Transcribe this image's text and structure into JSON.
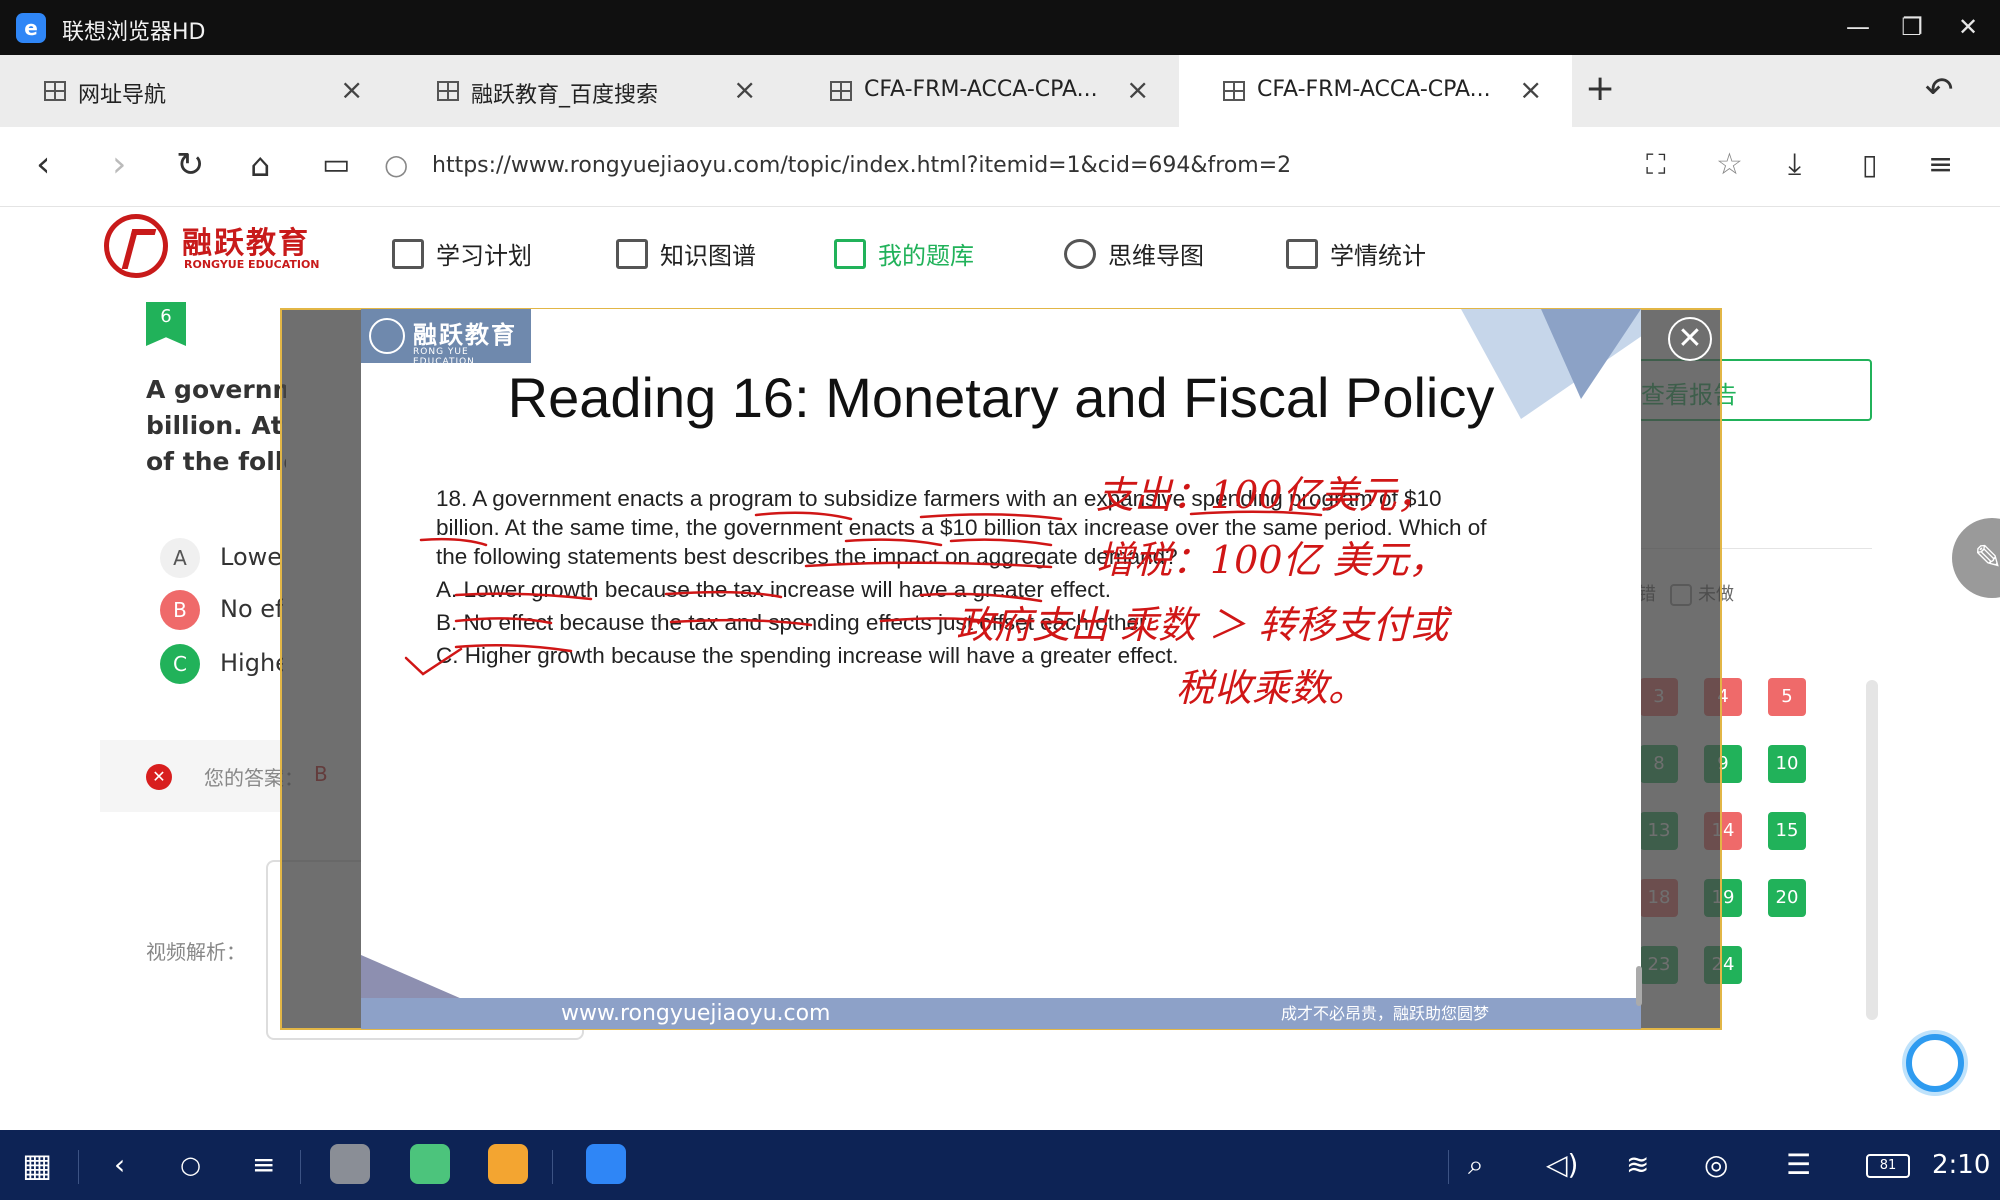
{
  "window": {
    "title": "联想浏览器HD",
    "minimize": "—",
    "restore": "❐",
    "close": "✕"
  },
  "tabs": [
    {
      "label": "网址导航"
    },
    {
      "label": "融跃教育_百度搜索"
    },
    {
      "label": "CFA-FRM-ACCA-CPA..."
    },
    {
      "label": "CFA-FRM-ACCA-CPA..."
    }
  ],
  "addressbar": {
    "url": "https://www.rongyuejiaoyu.com/topic/index.html?itemid=1&cid=694&from=2"
  },
  "site": {
    "logo_text": "融跃教育",
    "logo_sub": "RONGYUE EDUCATION",
    "nav": [
      {
        "label": "学习计划"
      },
      {
        "label": "知识图谱"
      },
      {
        "label": "我的题库"
      },
      {
        "label": "思维导图"
      },
      {
        "label": "学情统计"
      }
    ]
  },
  "question": {
    "number": "6",
    "text_lines": [
      "A government ena",
      "billion. At the sam",
      "of the following st"
    ],
    "options": [
      {
        "letter": "A",
        "text": "Lower growth"
      },
      {
        "letter": "B",
        "text": "No effect bec"
      },
      {
        "letter": "C",
        "text": "Higher growt"
      }
    ],
    "your_answer_label": "您的答案：",
    "your_answer": "B",
    "video_label": "视频解析："
  },
  "sidebar": {
    "report_button": "查看报告",
    "legend_wrong": "错",
    "legend_undone": "未做",
    "numbers": [
      {
        "n": "3",
        "status": "red"
      },
      {
        "n": "4",
        "status": "red"
      },
      {
        "n": "5",
        "status": "red"
      },
      {
        "n": "8",
        "status": "green"
      },
      {
        "n": "9",
        "status": "green"
      },
      {
        "n": "10",
        "status": "green"
      },
      {
        "n": "13",
        "status": "green"
      },
      {
        "n": "14",
        "status": "red"
      },
      {
        "n": "15",
        "status": "green"
      },
      {
        "n": "18",
        "status": "red"
      },
      {
        "n": "19",
        "status": "green"
      },
      {
        "n": "20",
        "status": "green"
      },
      {
        "n": "23",
        "status": "green"
      },
      {
        "n": "24",
        "status": "green"
      }
    ]
  },
  "video": {
    "brand": "融跃教育",
    "brand_sub": "RONG YUE EDUCATION",
    "title": "Reading 16: Monetary and Fiscal Policy",
    "question_lines": [
      "18. A government enacts a program to subsidize farmers with an expansive spending program of $10",
      "billion. At the same time, the government enacts a $10 billion tax increase over the same period. Which of",
      "the following statements best describes the impact on aggregate demand?",
      "A. Lower growth because the tax increase will have a greater effect.",
      "B. No effect because the tax and spending effects just offset each other.",
      "C. Higher growth because the spending increase will have a greater effect."
    ],
    "handwriting": [
      "支出：100亿美元，",
      "增税：100亿 美元，",
      "政府支出 乘数 ＞ 转移支付或",
      "税收乘数。"
    ],
    "footer_url": "www.rongyuejiaoyu.com",
    "footer_slogan": "成才不必昂贵，融跃助您圆梦",
    "close": "✕"
  },
  "taskbar": {
    "time": "2:10",
    "battery": "81"
  },
  "colors": {
    "accent_green": "#21b25a",
    "brand_red": "#c81a1a",
    "ink_red": "#d01616",
    "taskbar": "#0d2355"
  }
}
